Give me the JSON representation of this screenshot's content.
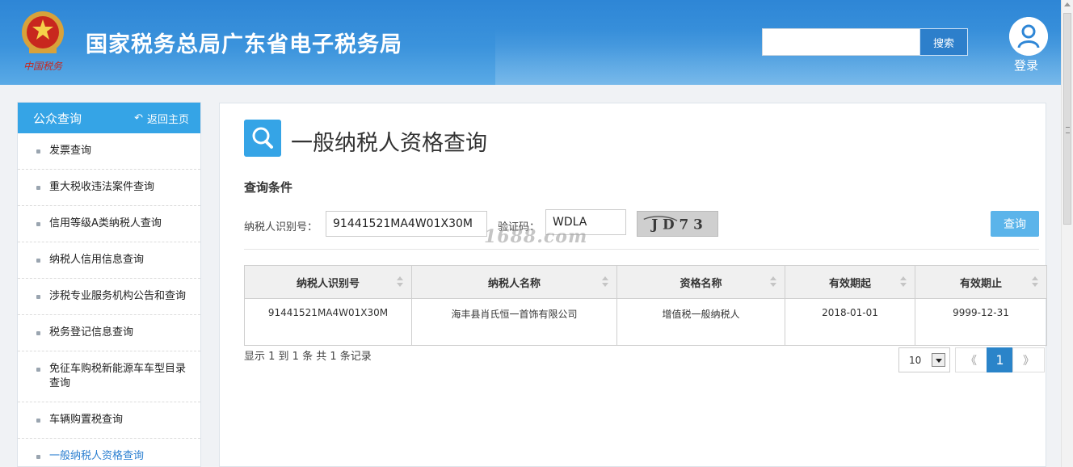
{
  "header": {
    "site_title": "国家税务总局广东省电子税务局",
    "emblem_text": "中国税务",
    "search_placeholder": "",
    "search_label": "搜索",
    "login_label": "登录"
  },
  "sidebar": {
    "title": "公众查询",
    "back_label": "返回主页",
    "items": [
      {
        "label": "发票查询"
      },
      {
        "label": "重大税收违法案件查询"
      },
      {
        "label": "信用等级A类纳税人查询"
      },
      {
        "label": "纳税人信用信息查询"
      },
      {
        "label": "涉税专业服务机构公告和查询"
      },
      {
        "label": "税务登记信息查询"
      },
      {
        "label": "免征车购税新能源车车型目录查询"
      },
      {
        "label": "车辆购置税查询"
      },
      {
        "label": "一般纳税人资格查询"
      }
    ]
  },
  "main": {
    "page_title": "一般纳税人资格查询",
    "conditions_label": "查询条件",
    "taxpayer_id_label": "纳税人识别号：",
    "taxpayer_id_value": "91441521MA4W01X30M",
    "captcha_label": "验证码：",
    "captcha_value": "WDLA",
    "captcha_image_text": "J D 7 3",
    "watermark": "1688.com",
    "query_button": "查询",
    "table": {
      "columns": [
        "纳税人识别号",
        "纳税人名称",
        "资格名称",
        "有效期起",
        "有效期止"
      ],
      "rows": [
        [
          "91441521MA4W01X30M",
          "海丰县肖氏恒一首饰有限公司",
          "增值税一般纳税人",
          "2018-01-01",
          "9999-12-31"
        ]
      ]
    },
    "summary": "显示 1 到 1 条 共 1 条记录",
    "page_size": "10",
    "pager": {
      "prev": "《",
      "current": "1",
      "next": "》"
    }
  },
  "colors": {
    "header_blue": "#2e86d6",
    "accent": "#35a4e6",
    "active_link": "#2b7fd0",
    "pager_active": "#2a84c9"
  }
}
